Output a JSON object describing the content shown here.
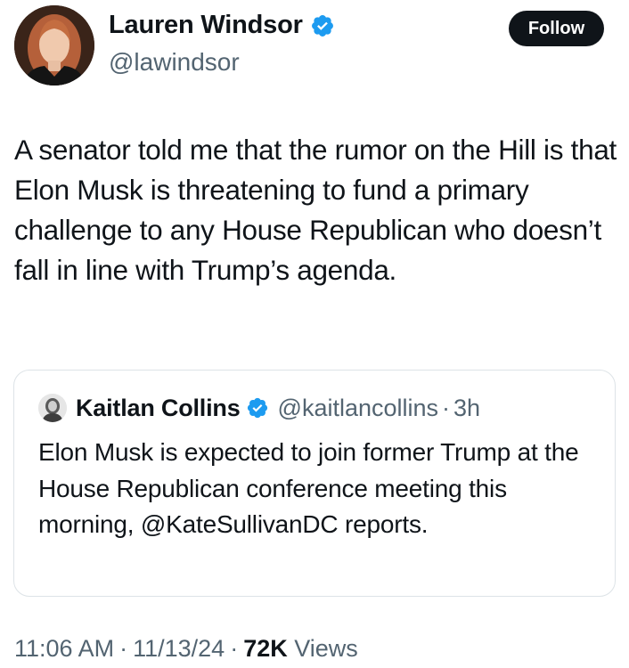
{
  "author": {
    "display_name": "Lauren Windsor",
    "handle": "@lawindsor",
    "verified": true
  },
  "follow_button": {
    "label": "Follow"
  },
  "tweet": {
    "text": "A senator told me that the rumor on the Hill is that Elon Musk is threatening to fund a primary challenge to any House Republican who doesn’t fall in line with Trump’s agenda."
  },
  "quoted_tweet": {
    "display_name": "Kaitlan Collins",
    "handle": "@kaitlancollins",
    "separator": "·",
    "time": "3h",
    "verified": true,
    "text": "Elon Musk is expected to join former Trump at the House Republican conference meeting this morning, @KateSullivanDC reports."
  },
  "meta": {
    "time": "11:06 AM",
    "separator": "·",
    "date": "11/13/24",
    "views_count": "72K",
    "views_label": "Views"
  },
  "colors": {
    "text_primary": "#0f1419",
    "text_secondary": "#536471",
    "verified_blue": "#1d9bf0",
    "border": "#dde3e7",
    "button_bg": "#0f1419"
  }
}
